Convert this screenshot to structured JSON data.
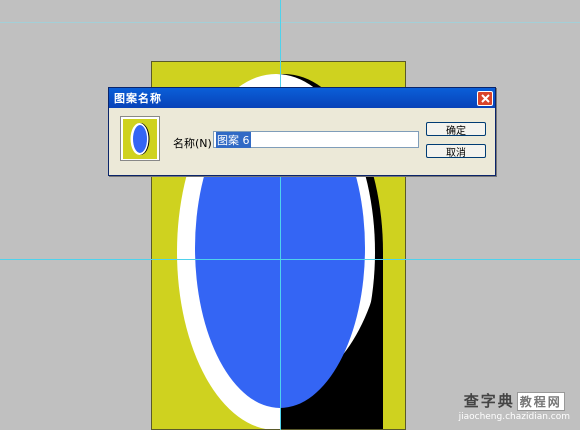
{
  "dialog": {
    "title": "图案名称",
    "name_label": "名称(N):",
    "name_value": "图案 6",
    "ok_label": "确定",
    "cancel_label": "取消",
    "close_icon": "close-icon"
  },
  "colors": {
    "canvas_bg": "#cfd21f",
    "ellipse_fill": "#3465f4",
    "guide": "#4fd2ec",
    "workspace": "#c0c0c0"
  },
  "watermark": {
    "main": "查字典",
    "box": "教程网",
    "sub": "jiaocheng.chazidian.com"
  }
}
